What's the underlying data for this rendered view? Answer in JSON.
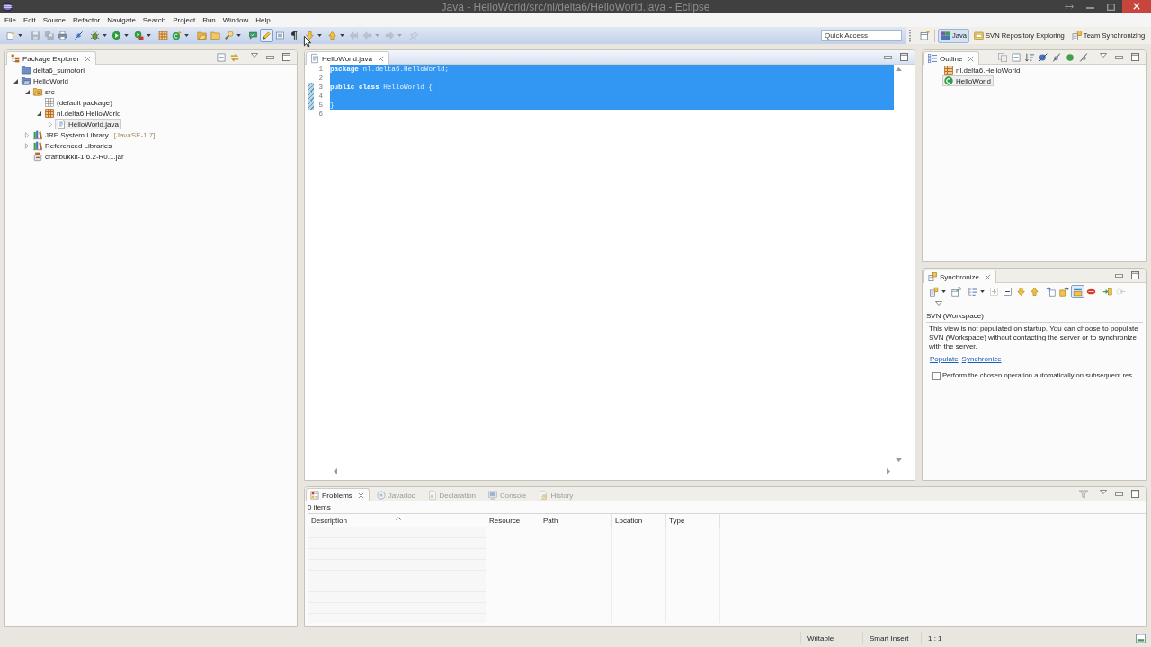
{
  "window": {
    "title": "Java - HelloWorld/src/nl/delta6/HelloWorld.java - Eclipse"
  },
  "menu": [
    "File",
    "Edit",
    "Source",
    "Refactor",
    "Navigate",
    "Search",
    "Project",
    "Run",
    "Window",
    "Help"
  ],
  "toolbar": {
    "buttons": [
      {
        "disabled": false,
        "pressed": false
      },
      {
        "disabled": true,
        "pressed": false
      },
      {
        "disabled": true,
        "pressed": false
      },
      {
        "disabled": false,
        "pressed": false
      },
      {
        "disabled": false,
        "pressed": false
      },
      {
        "disabled": false,
        "pressed": false
      },
      {
        "disabled": false,
        "pressed": false
      },
      {
        "disabled": false,
        "pressed": false
      },
      {
        "disabled": false,
        "pressed": false
      },
      {
        "disabled": false,
        "pressed": false
      },
      {
        "disabled": false,
        "pressed": false
      },
      {
        "disabled": false,
        "pressed": false
      },
      {
        "disabled": false,
        "pressed": false
      },
      {
        "disabled": false,
        "pressed": false
      },
      {
        "disabled": false,
        "pressed": true
      },
      {
        "disabled": false,
        "pressed": false
      },
      {
        "disabled": false,
        "pressed": false
      },
      {
        "disabled": false,
        "pressed": false
      },
      {
        "disabled": false,
        "pressed": false
      },
      {
        "disabled": true,
        "pressed": false
      },
      {
        "disabled": true,
        "pressed": false
      },
      {
        "disabled": true,
        "pressed": false
      },
      {
        "disabled": true,
        "pressed": false
      }
    ],
    "quick_access": {
      "placeholder": "Quick Access"
    },
    "perspectives": [
      {
        "label": "Java",
        "selected": true
      },
      {
        "label": "SVN Repository Exploring",
        "selected": false
      },
      {
        "label": "Team Synchronizing",
        "selected": false
      }
    ]
  },
  "package_explorer": {
    "title": "Package Explorer",
    "tree": [
      {
        "label": "delta6_sumotori",
        "kind": "project",
        "selected": false
      },
      {
        "label": "HelloWorld",
        "kind": "project",
        "selected": false,
        "expanded": true,
        "children": [
          {
            "label": "src",
            "kind": "folder",
            "selected": false,
            "expanded": true,
            "children": [
              {
                "label": "(default package)",
                "kind": "emptypackage",
                "selected": false
              },
              {
                "label": "nl.delta6.HelloWorld",
                "kind": "package",
                "selected": false,
                "expanded": true,
                "children": [
                  {
                    "label": "HelloWorld.java",
                    "kind": "file",
                    "selected": true,
                    "expanded": false
                  }
                ]
              }
            ]
          },
          {
            "label": "JRE System Library",
            "decoration": "[JavaSE-1.7]",
            "kind": "library",
            "selected": false,
            "expanded": false
          },
          {
            "label": "Referenced Libraries",
            "kind": "library",
            "selected": false,
            "expanded": false
          },
          {
            "label": "craftbukkit-1.6.2-R0.1.jar",
            "kind": "archive",
            "selected": false
          }
        ]
      }
    ]
  },
  "editor": {
    "tabs": [
      {
        "label": "HelloWorld.java",
        "selected": true
      }
    ],
    "lines": [
      {
        "number": "1",
        "selected": true,
        "changed": false,
        "tokens": [
          {
            "text": "package",
            "kind": "keyword"
          },
          {
            "text": " nl.delta6.HelloWorld;",
            "kind": "plain"
          }
        ]
      },
      {
        "number": "2",
        "selected": true,
        "changed": false
      },
      {
        "number": "3",
        "selected": true,
        "changed": true,
        "tokens": [
          {
            "text": "public class",
            "kind": "keyword"
          },
          {
            "text": " HelloWorld {",
            "kind": "plain"
          }
        ]
      },
      {
        "number": "4",
        "selected": true,
        "changed": true
      },
      {
        "number": "5",
        "selected": true,
        "changed": true,
        "tokens": [
          {
            "text": "}",
            "kind": "plain"
          }
        ]
      },
      {
        "number": "6",
        "selected": false,
        "changed": false
      }
    ]
  },
  "outline": {
    "title": "Outline",
    "items": [
      {
        "label": "nl.delta6.HelloWorld",
        "kind": "package",
        "selected": false
      },
      {
        "label": "HelloWorld",
        "kind": "class",
        "selected": true
      }
    ]
  },
  "synchronize": {
    "title": "Synchronize",
    "buttons": [
      {
        "disabled": false,
        "pressed": false
      },
      {
        "disabled": false,
        "pressed": false
      },
      {
        "disabled": false,
        "pressed": false
      },
      {
        "disabled": true,
        "pressed": false
      },
      {
        "disabled": false,
        "pressed": false
      },
      {
        "disabled": false,
        "pressed": false
      },
      {
        "disabled": false,
        "pressed": false
      },
      {
        "disabled": false,
        "pressed": false
      },
      {
        "disabled": false,
        "pressed": false
      },
      {
        "disabled": false,
        "pressed": true
      },
      {
        "disabled": false,
        "pressed": false
      },
      {
        "disabled": false,
        "pressed": false
      },
      {
        "disabled": true,
        "pressed": false
      }
    ],
    "heading": "SVN (Workspace)",
    "message": "This view is not populated on startup. You can choose to populate SVN (Workspace) without contacting the server or to synchronize with the server.",
    "links": [
      "Populate",
      "Synchronize"
    ],
    "checkbox": {
      "label": "Perform the chosen operation automatically on subsequent res",
      "checked": false
    }
  },
  "problems": {
    "tabs": [
      {
        "label": "Problems",
        "selected": true
      },
      {
        "label": "Javadoc",
        "selected": false
      },
      {
        "label": "Declaration",
        "selected": false
      },
      {
        "label": "Console",
        "selected": false
      },
      {
        "label": "History",
        "selected": false
      }
    ],
    "summary": "0 items",
    "columns": [
      {
        "label": "Description",
        "sorted": true
      },
      {
        "label": "Resource",
        "sorted": false
      },
      {
        "label": "Path",
        "sorted": false
      },
      {
        "label": "Location",
        "sorted": false
      },
      {
        "label": "Type",
        "sorted": false
      }
    ]
  },
  "status_bar": [
    "Writable",
    "Smart Insert",
    "1 : 1"
  ]
}
